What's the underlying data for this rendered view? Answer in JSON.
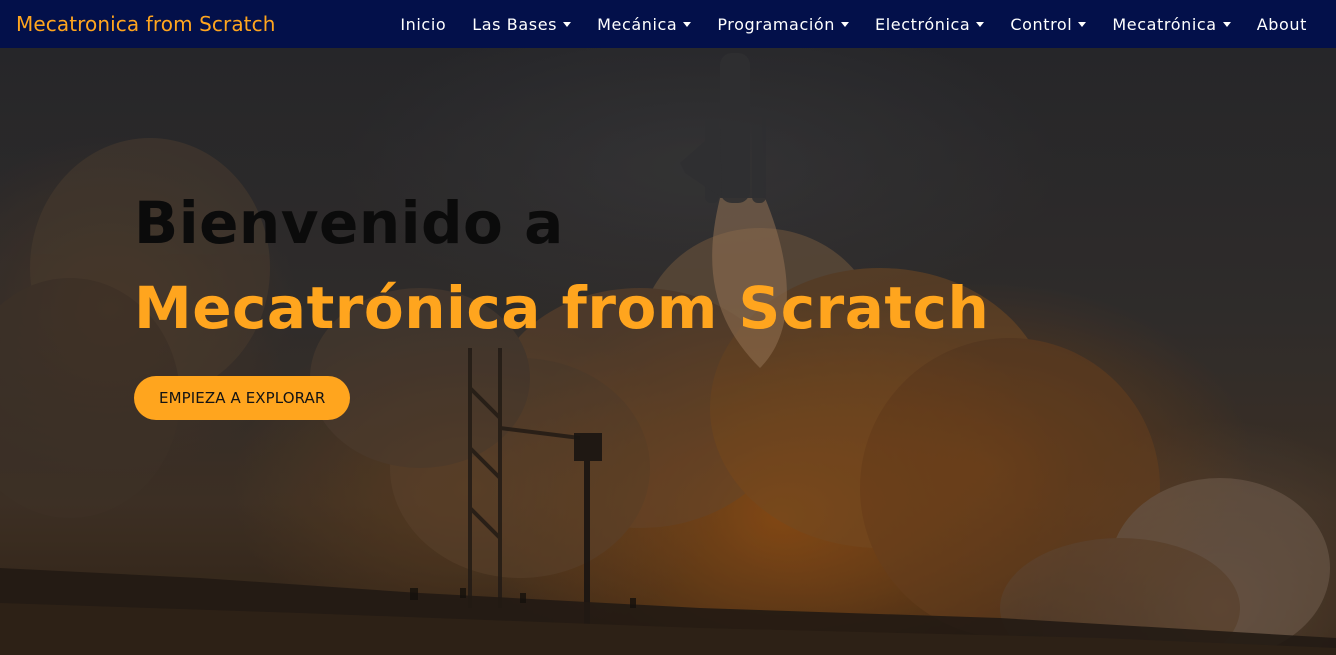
{
  "navbar": {
    "brand": "Mecatronica from Scratch",
    "items": [
      {
        "label": "Inicio",
        "dropdown": false
      },
      {
        "label": "Las Bases",
        "dropdown": true
      },
      {
        "label": "Mecánica",
        "dropdown": true
      },
      {
        "label": "Programación",
        "dropdown": true
      },
      {
        "label": "Electrónica",
        "dropdown": true
      },
      {
        "label": "Control",
        "dropdown": true
      },
      {
        "label": "Mecatrónica",
        "dropdown": true
      },
      {
        "label": "About",
        "dropdown": false
      }
    ]
  },
  "hero": {
    "welcome": "Bienvenido a",
    "site_name": "Mecatrónica from Scratch",
    "cta_label": "EMPIEZA A EXPLORAR",
    "background_image": "rocket-launch-photo"
  },
  "colors": {
    "navbar_bg": "#03104a",
    "accent": "#ffa51e",
    "nav_text": "#ffffff",
    "welcome_text": "#0b0b0b"
  }
}
